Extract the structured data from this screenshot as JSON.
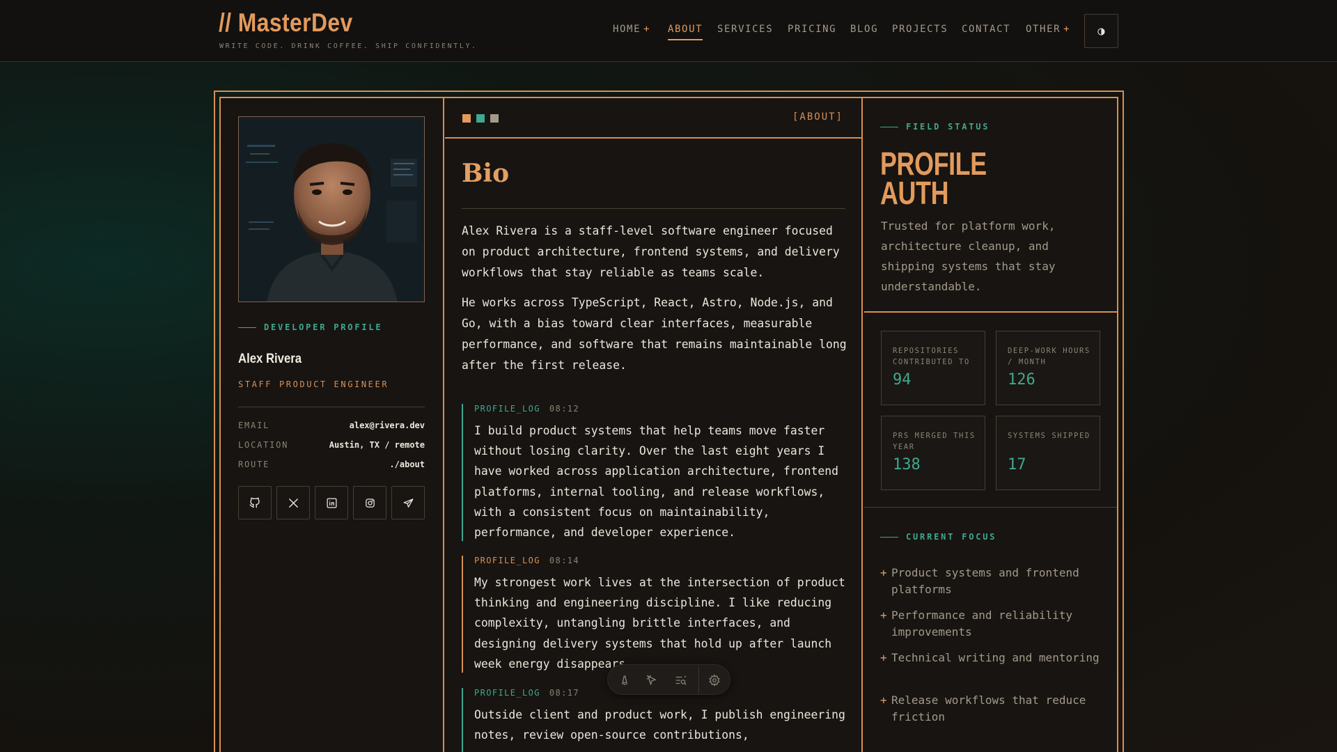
{
  "header": {
    "logo": "// MasterDev",
    "tagline": "WRITE CODE. DRINK COFFEE. SHIP CONFIDENTLY.",
    "nav": [
      {
        "label": "HOME",
        "has_plus": true,
        "active": false
      },
      {
        "label": "ABOUT",
        "has_plus": false,
        "active": true
      },
      {
        "label": "SERVICES",
        "has_plus": false,
        "active": false
      },
      {
        "label": "PRICING",
        "has_plus": false,
        "active": false
      },
      {
        "label": "BLOG",
        "has_plus": false,
        "active": false
      },
      {
        "label": "PROJECTS",
        "has_plus": false,
        "active": false
      },
      {
        "label": "CONTACT",
        "has_plus": false,
        "active": false
      },
      {
        "label": "OTHER",
        "has_plus": true,
        "active": false
      }
    ],
    "plus_glyph": "+",
    "theme_toggle_icon": "contrast-icon",
    "theme_toggle_glyph": "◑"
  },
  "profile": {
    "section_label": "DEVELOPER PROFILE",
    "name": "Alex Rivera",
    "role": "STAFF PRODUCT ENGINEER",
    "details": [
      {
        "key": "EMAIL",
        "value": "alex@rivera.dev"
      },
      {
        "key": "LOCATION",
        "value": "Austin, TX / remote"
      },
      {
        "key": "ROUTE",
        "value": "./about"
      }
    ],
    "socials": [
      "github-icon",
      "x-icon",
      "linkedin-icon",
      "instagram-icon",
      "telegram-icon"
    ]
  },
  "bio": {
    "panel_tag": "[ABOUT]",
    "title": "Bio",
    "paragraphs": [
      "Alex Rivera is a staff-level software engineer focused on product architecture, frontend systems, and delivery workflows that stay reliable as teams scale.",
      "He works across TypeScript, React, Astro, Node.js, and Go, with a bias toward clear interfaces, measurable performance, and software that remains maintainable long after the first release."
    ],
    "logs": [
      {
        "tag": "PROFILE_LOG",
        "time": "08:12",
        "text": "I build product systems that help teams move faster without losing clarity. Over the last eight years I have worked across application architecture, frontend platforms, internal tooling, and release workflows, with a consistent focus on maintainability, performance, and developer experience."
      },
      {
        "tag": "PROFILE_LOG",
        "time": "08:14",
        "text": "My strongest work lives at the intersection of product thinking and engineering discipline. I like reducing complexity, untangling brittle interfaces, and designing delivery systems that hold up after launch week energy disappears."
      },
      {
        "tag": "PROFILE_LOG",
        "time": "08:17",
        "text": "Outside client and product work, I publish engineering notes, review open-source contributions,"
      }
    ]
  },
  "status": {
    "section_label": "FIELD STATUS",
    "title_line1": "PROFILE",
    "title_line2": "AUTH",
    "description": "Trusted for platform work, architecture cleanup, and shipping systems that stay understandable.",
    "stats": [
      {
        "label": "REPOSITORIES CONTRIBUTED TO",
        "value": "94"
      },
      {
        "label": "DEEP-WORK HOURS / MONTH",
        "value": "126"
      },
      {
        "label": "PRS MERGED THIS YEAR",
        "value": "138"
      },
      {
        "label": "SYSTEMS SHIPPED",
        "value": "17"
      }
    ],
    "focus_label": "CURRENT FOCUS",
    "focus_items": [
      "Product systems and frontend platforms",
      "Performance and reliability improvements",
      "Technical writing and mentoring",
      "Release workflows that reduce friction"
    ]
  },
  "toolbar": {
    "buttons": [
      "astro-icon",
      "inspect-icon",
      "audit-icon",
      "settings-icon"
    ]
  },
  "colors": {
    "accent": "#e39a5c",
    "teal": "#3fa88e",
    "dot1": "#e39a5c",
    "dot2": "#3fa88e",
    "dot3": "#a49a8a"
  }
}
